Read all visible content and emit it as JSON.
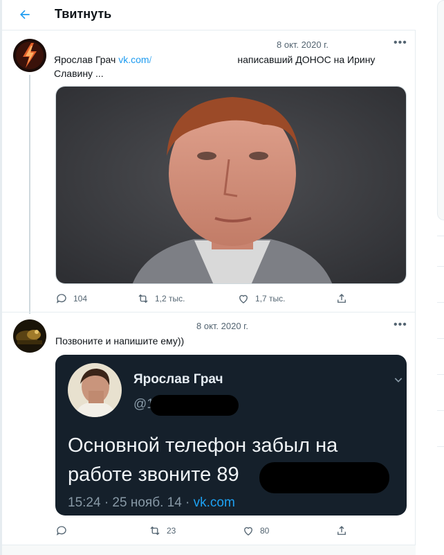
{
  "header": {
    "title": "Твитнуть"
  },
  "tweet1": {
    "date": "8 окт. 2020 г.",
    "text_before_link": "Ярослав Грач ",
    "link": "vk.com/",
    "text_after_redaction": " написавший ДОНОС на Ирину",
    "text_line2": "Славину ...",
    "reply_count": "104",
    "retweet_count": "1,2 тыс.",
    "like_count": "1,7 тыс."
  },
  "tweet2": {
    "date": "8 окт. 2020 г.",
    "text": "Позвоните и напишите ему))",
    "reply_count": "",
    "retweet_count": "23",
    "like_count": "80",
    "embedded": {
      "name": "Ярослав Грач",
      "handle_prefix": "@1",
      "body_line1": "Основной телефон забыл на",
      "body_line2": "работе звоните 89",
      "time": "15:24 · 25 нояб. 14 · ",
      "source": "vk.com"
    }
  },
  "colors": {
    "accent": "#1d9bf0",
    "text": "#0f1419",
    "muted": "#536471",
    "dark_card_bg": "#15202b"
  },
  "icons": [
    "back-arrow-icon",
    "more-icon",
    "reply-icon",
    "retweet-icon",
    "like-icon",
    "share-icon",
    "chevron-down-icon"
  ]
}
